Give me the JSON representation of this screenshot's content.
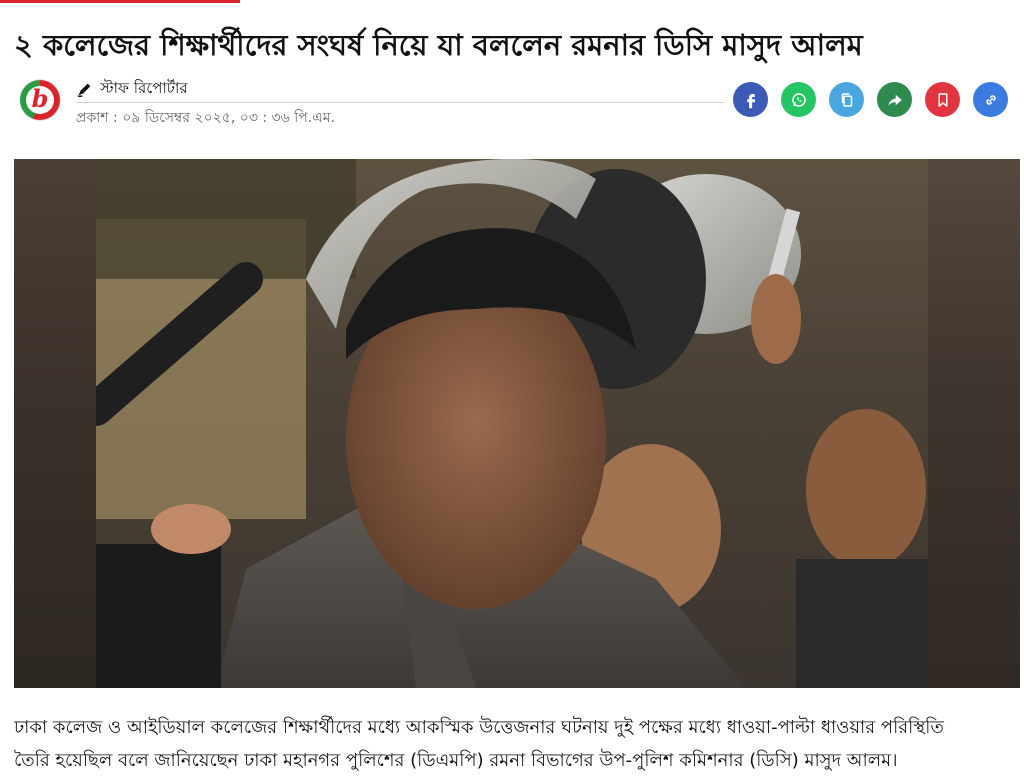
{
  "article": {
    "headline": "২ কলেজের শিক্ষার্থীদের সংঘর্ষ নিয়ে যা বললেন রমনার ডিসি মাসুদ আলম",
    "author": "স্টাফ রিপোর্টার",
    "published": "প্রকাশ : ০৯ ডিসেম্বর ২০২৫, ০৩ : ৩৬ পি.এম.",
    "logo_glyph": "b",
    "body_lines": [
      "ঢাকা কলেজ ও আইডিয়াল কলেজের শিক্ষার্থীদের মধ্যে আকস্মিক উত্তেজনার ঘটনায় দুই পক্ষের মধ্যে ধাওয়া-পাল্টা ধাওয়ার পরিস্থিতি",
      "তৈরি হয়েছিল বলে জানিয়েছেন ঢাকা মহানগর পুলিশের (ডিএমপি) রমনা বিভাগের উপ-পুলিশ কমিশনার (ডিসি) মাসুদ আলম।"
    ]
  },
  "share": {
    "icons": [
      "facebook-icon",
      "whatsapp-icon",
      "copy-icon",
      "share-icon",
      "bookmark-icon",
      "link-icon"
    ],
    "colors": {
      "facebook": "#3b5bb6",
      "whatsapp": "#25c564",
      "copy": "#4aa6de",
      "share": "#2f8a4e",
      "bookmark": "#e0343f",
      "link": "#3a7be0"
    }
  },
  "theme": {
    "accent": "#d9232d",
    "brand_green": "#2c9a43"
  }
}
